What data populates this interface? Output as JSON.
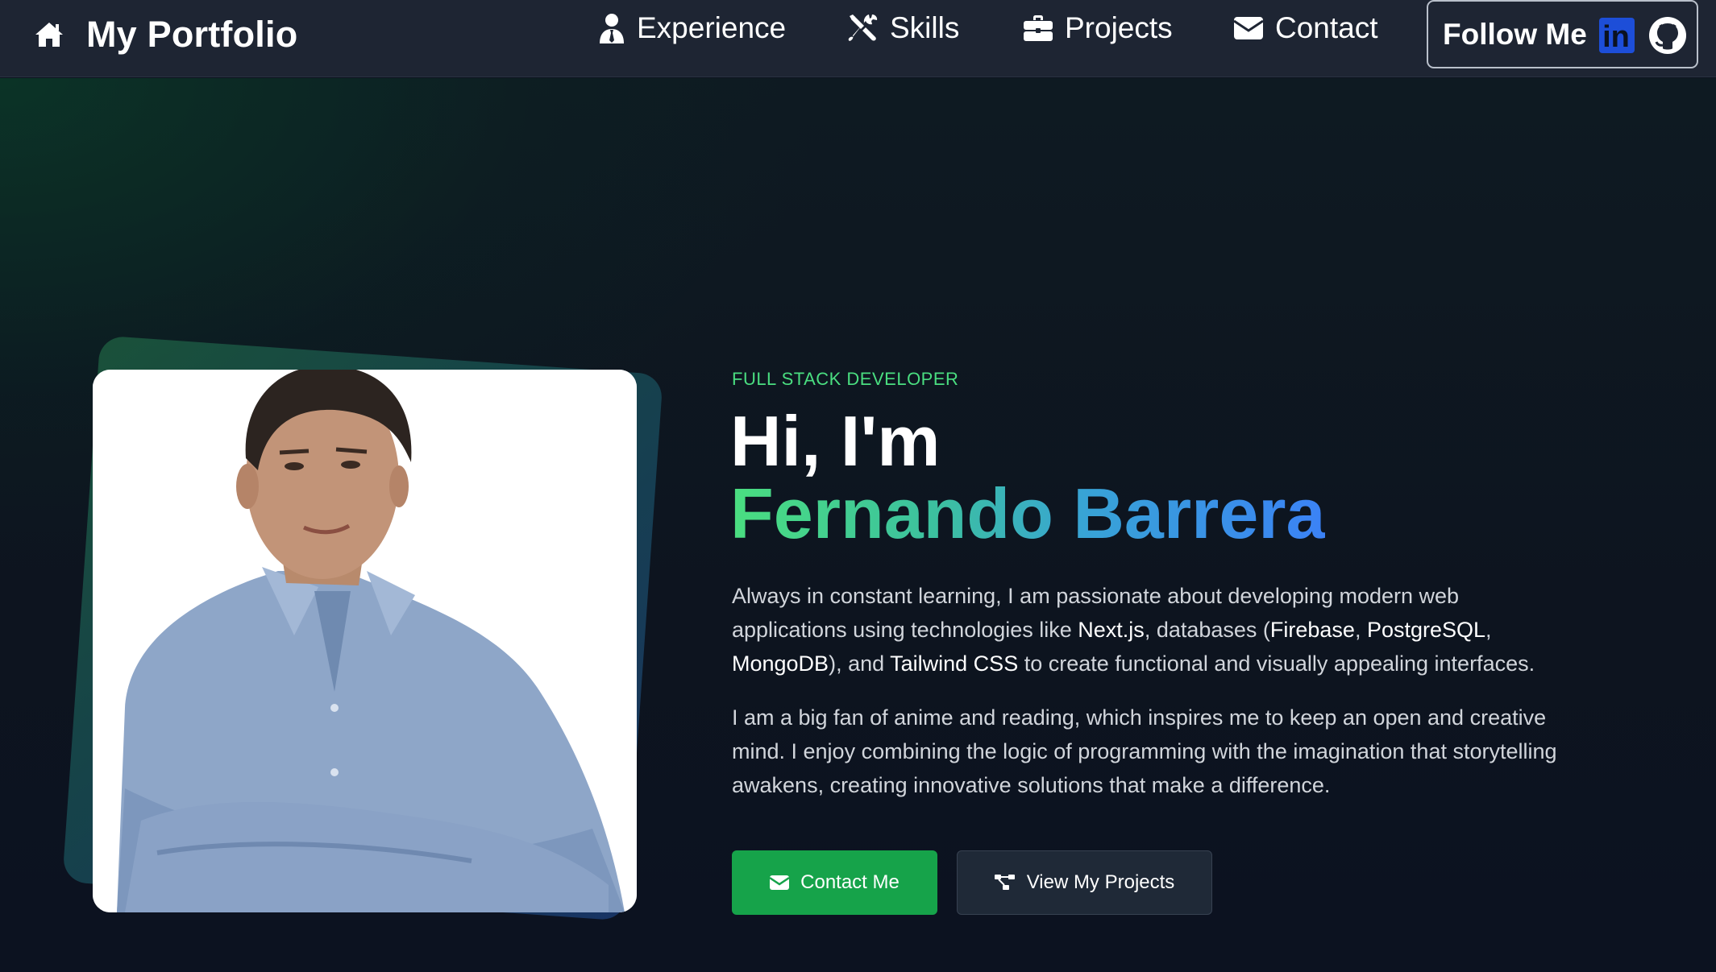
{
  "nav": {
    "brand": "My Portfolio",
    "brand_icon": "home-icon",
    "links": [
      {
        "label": "Experience",
        "icon": "user-tie-icon"
      },
      {
        "label": "Skills",
        "icon": "tools-icon"
      },
      {
        "label": "Projects",
        "icon": "briefcase-icon"
      },
      {
        "label": "Contact",
        "icon": "envelope-icon"
      }
    ],
    "follow": {
      "label": "Follow Me",
      "linkedin_icon": "linkedin-icon",
      "linkedin_text": "in",
      "github_icon": "github-icon"
    }
  },
  "hero": {
    "eyebrow": "FULL STACK DEVELOPER",
    "greeting": "Hi, I'm",
    "name": "Fernando Barrera",
    "paragraph1": {
      "t1": "Always in constant learning, I am passionate about developing modern web applications using technologies like ",
      "h1": "Next.js",
      "t2": ", databases (",
      "h2": "Firebase",
      "t3": ", ",
      "h3": "PostgreSQL",
      "t4": ", ",
      "h4": "MongoDB",
      "t5": "), and ",
      "h5": "Tailwind CSS",
      "t6": " to create functional and visually appealing interfaces."
    },
    "paragraph2": "I am a big fan of anime and reading, which inspires me to keep an open and creative mind. I enjoy combining the logic of programming with the imagination that storytelling awakens, creating innovative solutions that make a difference.",
    "buttons": {
      "contact": {
        "label": "Contact Me",
        "icon": "envelope-icon"
      },
      "projects": {
        "label": "View My Projects",
        "icon": "project-diagram-icon"
      }
    }
  },
  "colors": {
    "nav_bg": "#1e2533",
    "accent_green": "#4ade80",
    "button_green": "#16a34a",
    "gradient_blue": "#3b82f6",
    "linkedin_blue": "#1d4ed8"
  }
}
